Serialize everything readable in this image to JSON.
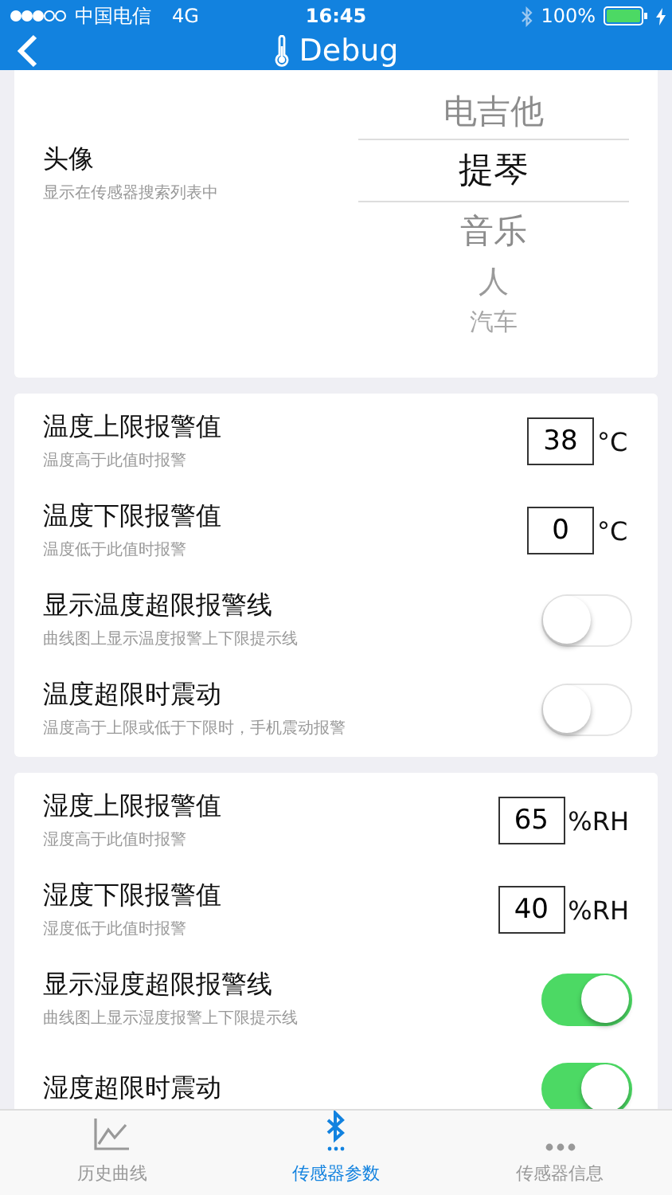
{
  "status_bar": {
    "carrier": "中国电信",
    "network": "4G",
    "time": "16:45",
    "battery": "100%"
  },
  "nav": {
    "title": "Debug"
  },
  "avatar": {
    "title": "头像",
    "subtitle": "显示在传感器搜索列表中",
    "options": [
      {
        "label": "电吉他",
        "selected": false
      },
      {
        "label": "提琴",
        "selected": true
      },
      {
        "label": "音乐",
        "selected": false
      },
      {
        "label": "人",
        "selected": false
      },
      {
        "label": "汽车",
        "selected": false
      }
    ]
  },
  "sections": [
    {
      "rows": [
        {
          "kind": "number",
          "title": "温度上限报警值",
          "subtitle": "温度高于此值时报警",
          "value": "38",
          "unit": "°C"
        },
        {
          "kind": "number",
          "title": "温度下限报警值",
          "subtitle": "温度低于此值时报警",
          "value": "0",
          "unit": "°C"
        },
        {
          "kind": "toggle",
          "title": "显示温度超限报警线",
          "subtitle": "曲线图上显示温度报警上下限提示线",
          "on": false
        },
        {
          "kind": "toggle",
          "title": "温度超限时震动",
          "subtitle": "温度高于上限或低于下限时，手机震动报警",
          "on": false
        }
      ]
    },
    {
      "rows": [
        {
          "kind": "number",
          "title": "湿度上限报警值",
          "subtitle": "湿度高于此值时报警",
          "value": "65",
          "unit": "%RH"
        },
        {
          "kind": "number",
          "title": "湿度下限报警值",
          "subtitle": "湿度低于此值时报警",
          "value": "40",
          "unit": "%RH"
        },
        {
          "kind": "toggle",
          "title": "显示湿度超限报警线",
          "subtitle": "曲线图上显示湿度报警上下限提示线",
          "on": true
        },
        {
          "kind": "toggle",
          "title": "湿度超限时震动",
          "on": true
        }
      ]
    }
  ],
  "tabs": [
    {
      "label": "历史曲线",
      "kind": "chart",
      "selected": false
    },
    {
      "label": "传感器参数",
      "kind": "bluetooth",
      "selected": true
    },
    {
      "label": "传感器信息",
      "kind": "more",
      "selected": false
    }
  ]
}
